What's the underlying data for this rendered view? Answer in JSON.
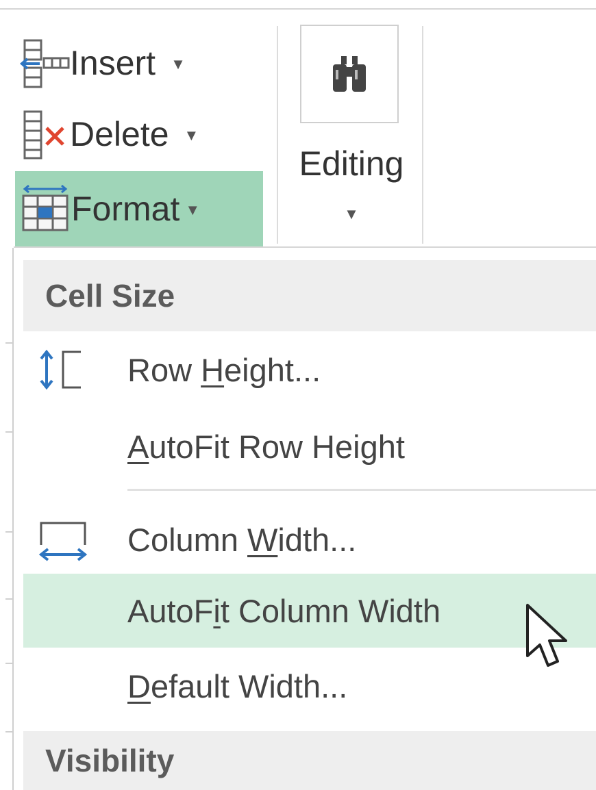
{
  "ribbon": {
    "cells_group": {
      "insert": {
        "label": "Insert",
        "icon": "insert-cells-icon"
      },
      "delete": {
        "label": "Delete",
        "icon": "delete-cells-icon"
      },
      "format": {
        "label": "Format",
        "icon": "format-cells-icon",
        "active": true
      }
    },
    "editing_group": {
      "label": "Editing",
      "find_icon": "binoculars-icon"
    }
  },
  "menu": {
    "sections": [
      {
        "header": "Cell Size",
        "items": [
          {
            "pre": "Row ",
            "key": "H",
            "post": "eight...",
            "icon": "row-height-icon"
          },
          {
            "pre": "",
            "key": "A",
            "post": "utoFit Row Height"
          },
          {
            "pre": "Column ",
            "key": "W",
            "post": "idth...",
            "icon": "column-width-icon"
          },
          {
            "pre": "AutoF",
            "key": "i",
            "post": "t Column Width",
            "highlighted": true
          },
          {
            "pre": "",
            "key": "D",
            "post": "efault Width..."
          }
        ]
      },
      {
        "header": "Visibility",
        "items": []
      }
    ]
  },
  "colors": {
    "format_active_bg": "#9fd5b8",
    "menu_hover_bg": "#d6efe0",
    "section_header_bg": "#eeeeee",
    "icon_blue": "#2e75c0",
    "icon_red": "#e0452f"
  }
}
